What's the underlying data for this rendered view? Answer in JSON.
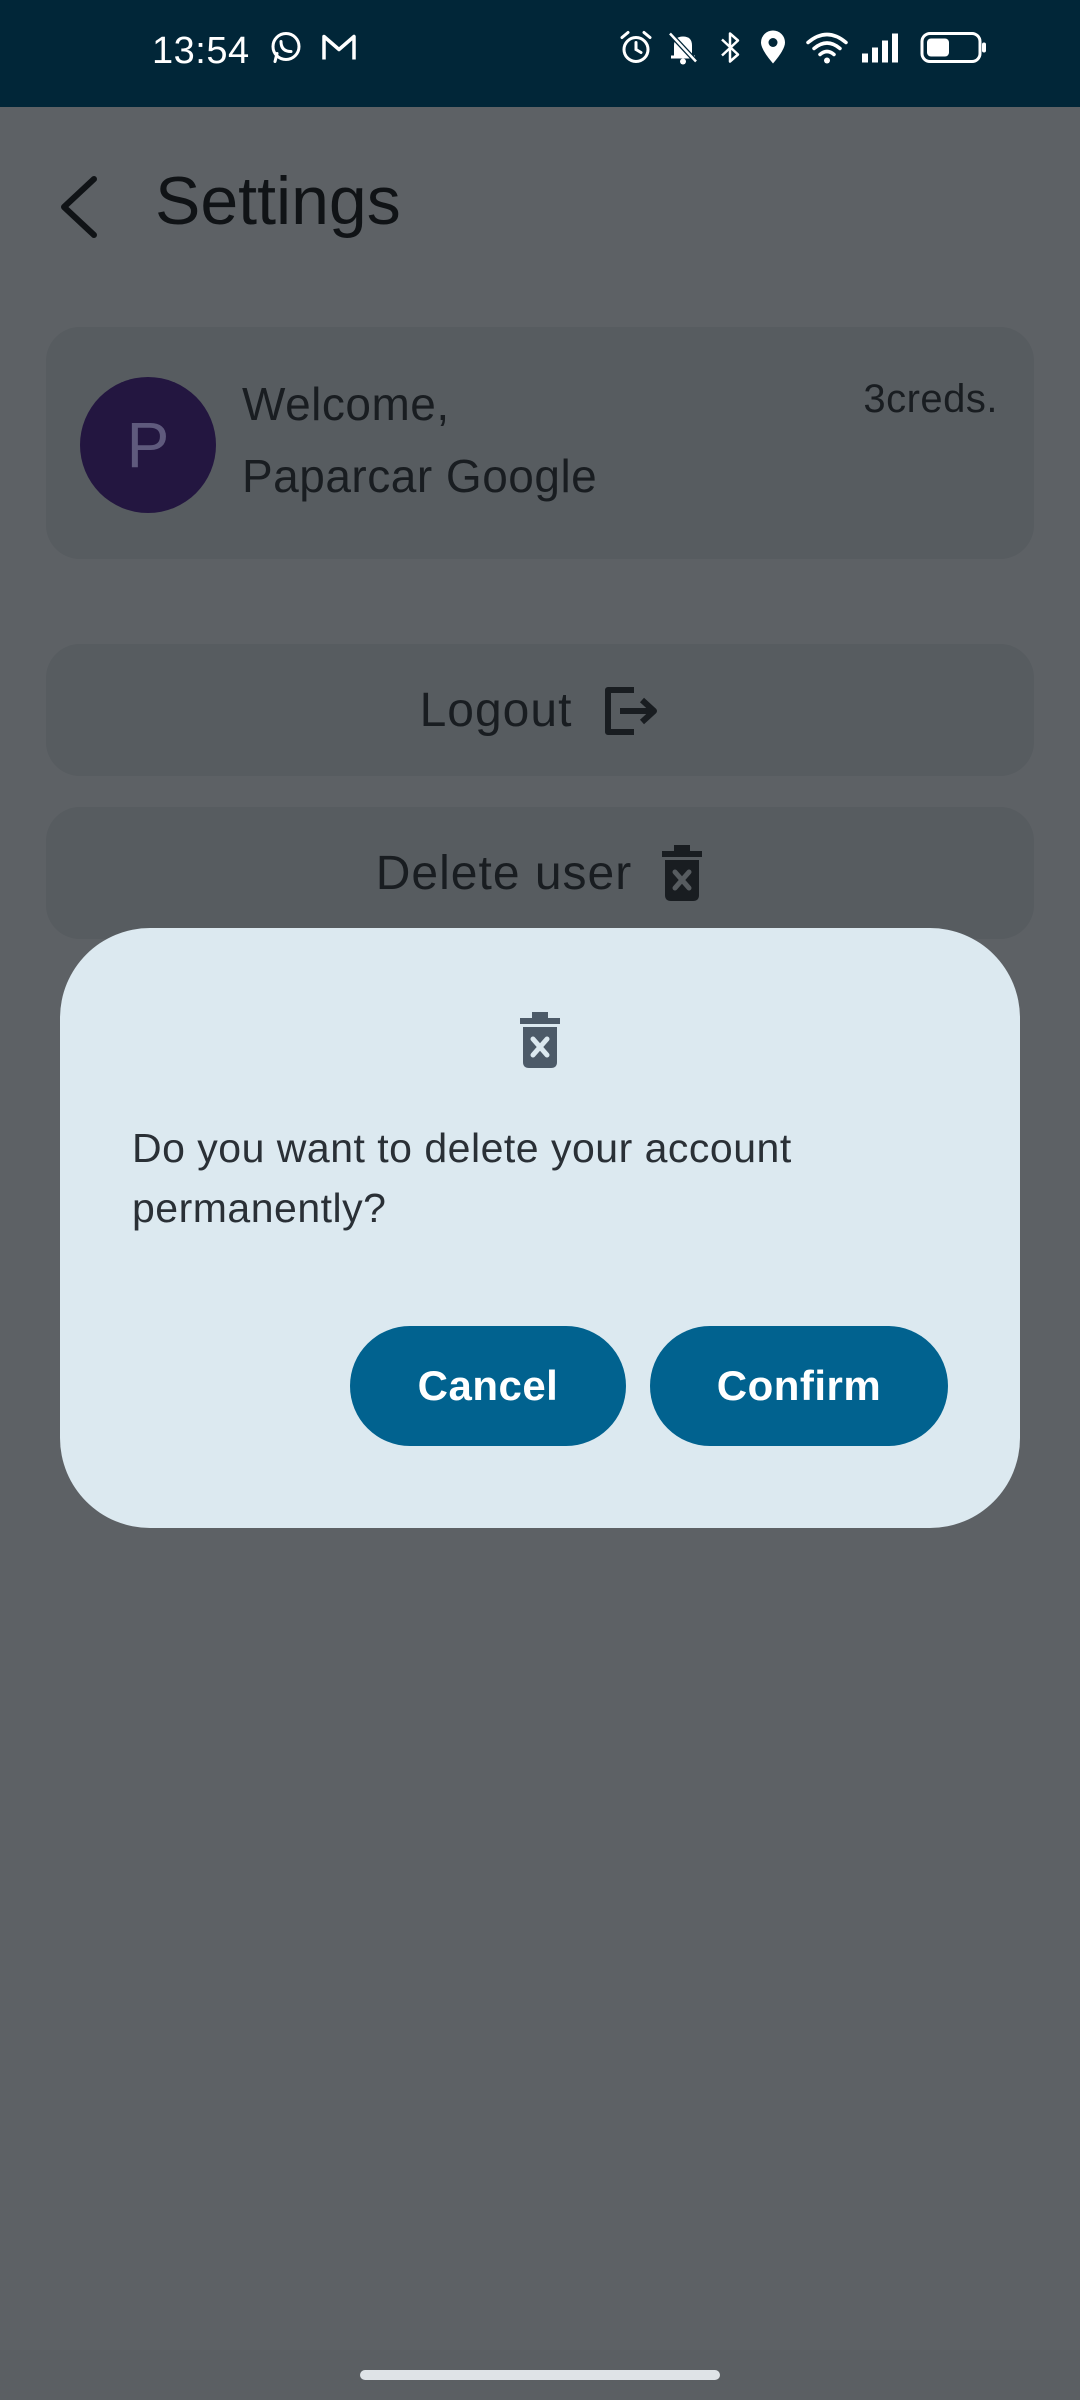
{
  "status_bar": {
    "time": "13:54",
    "left_icons": [
      "whatsapp-icon",
      "gmail-icon"
    ],
    "right_icons": [
      "alarm-icon",
      "bell-off-icon",
      "bluetooth-icon",
      "location-icon",
      "wifi-icon",
      "signal-icon",
      "battery-icon"
    ]
  },
  "header": {
    "title": "Settings"
  },
  "profile": {
    "avatar_letter": "P",
    "greeting": "Welcome,",
    "name": "Paparcar Google",
    "credits": "3creds."
  },
  "actions": {
    "logout_label": "Logout",
    "delete_label": "Delete user"
  },
  "dialog": {
    "message": "Do you want to delete your account permanently?",
    "cancel_label": "Cancel",
    "confirm_label": "Confirm"
  },
  "colors": {
    "status_bar": "#012638",
    "scrim_background": "#5d6165",
    "dialog_background": "#dce9f0",
    "primary_button": "#01628f",
    "avatar": "#231640"
  }
}
